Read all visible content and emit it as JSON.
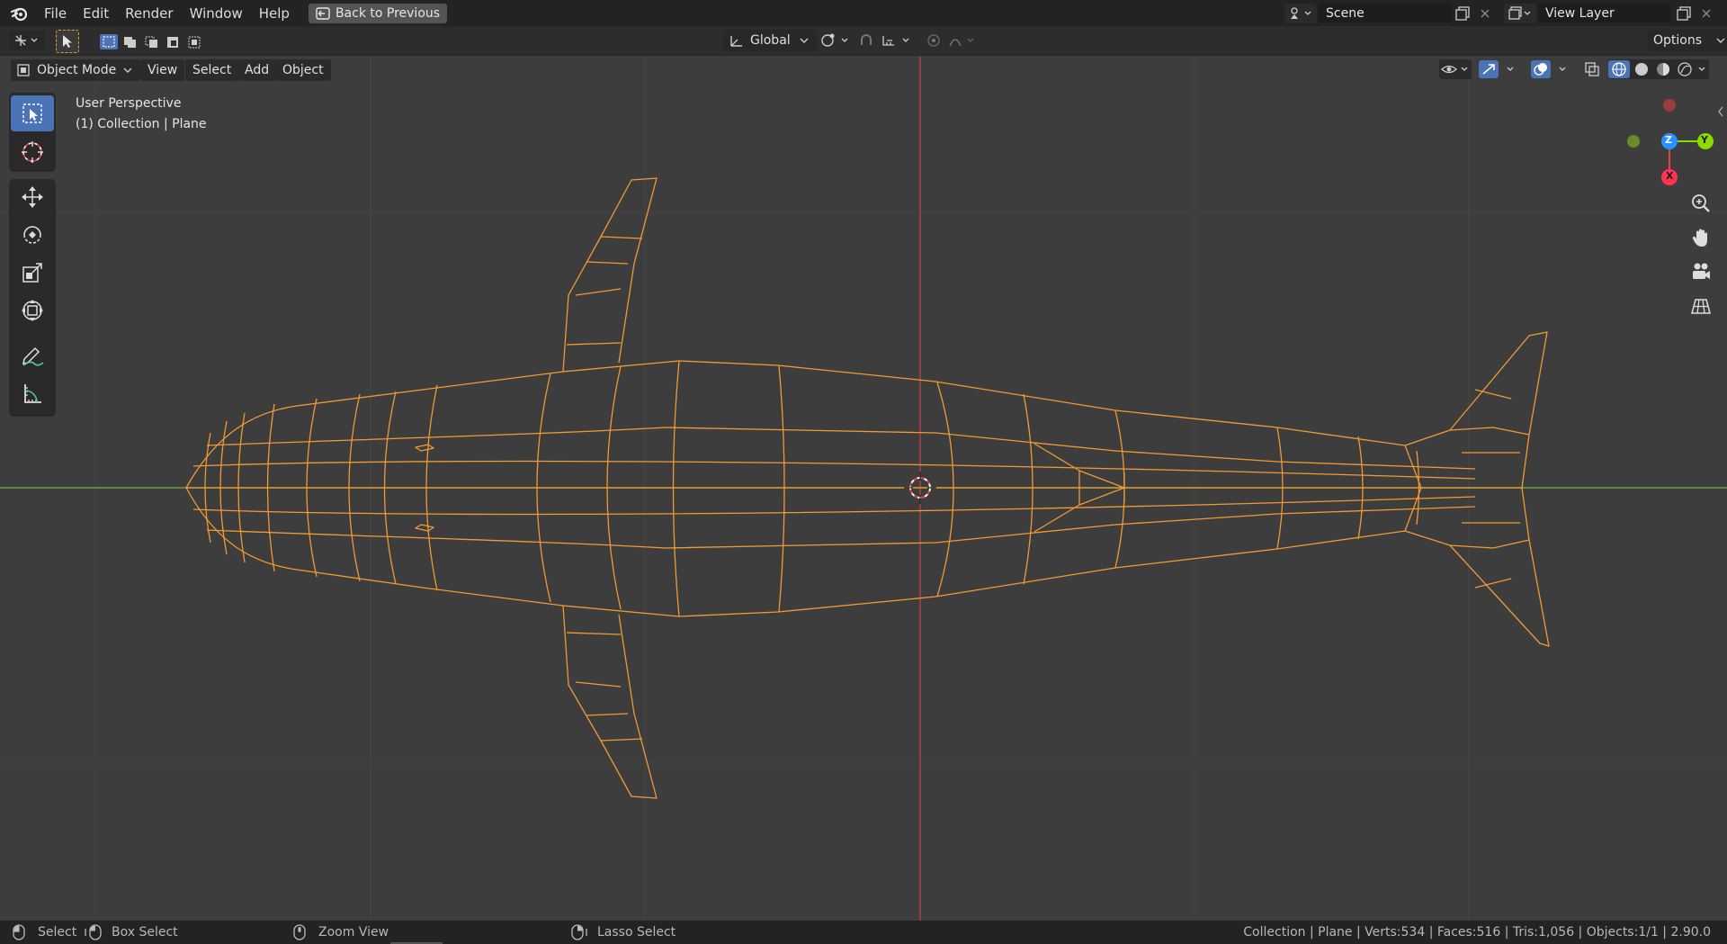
{
  "menu": {
    "items": [
      "File",
      "Edit",
      "Render",
      "Window",
      "Help"
    ],
    "back_label": "Back to Previous"
  },
  "scene": {
    "name": "Scene"
  },
  "view_layer": {
    "name": "View Layer"
  },
  "toolbar": {
    "orientation": "Global",
    "options_label": "Options"
  },
  "viewport_header": {
    "mode": "Object Mode",
    "menus": [
      "View",
      "Select",
      "Add",
      "Object"
    ]
  },
  "viewport": {
    "perspective_label": "User Perspective",
    "collection_label": "(1) Collection | Plane"
  },
  "gizmo": {
    "axes": [
      "Z",
      "Y",
      "X"
    ]
  },
  "status": {
    "select": "Select",
    "box_select": "Box Select",
    "zoom_view": "Zoom View",
    "lasso_select": "Lasso Select",
    "stats": "Collection | Plane | Verts:534 | Faces:516 | Tris:1,056 | Objects:1/1 | 2.90.0"
  },
  "colors": {
    "selection_orange": "#f09a35",
    "x_axis": "#ff3352",
    "y_axis": "#8bdc00",
    "z_axis": "#2890ff",
    "active_tool": "#4a74b5"
  }
}
